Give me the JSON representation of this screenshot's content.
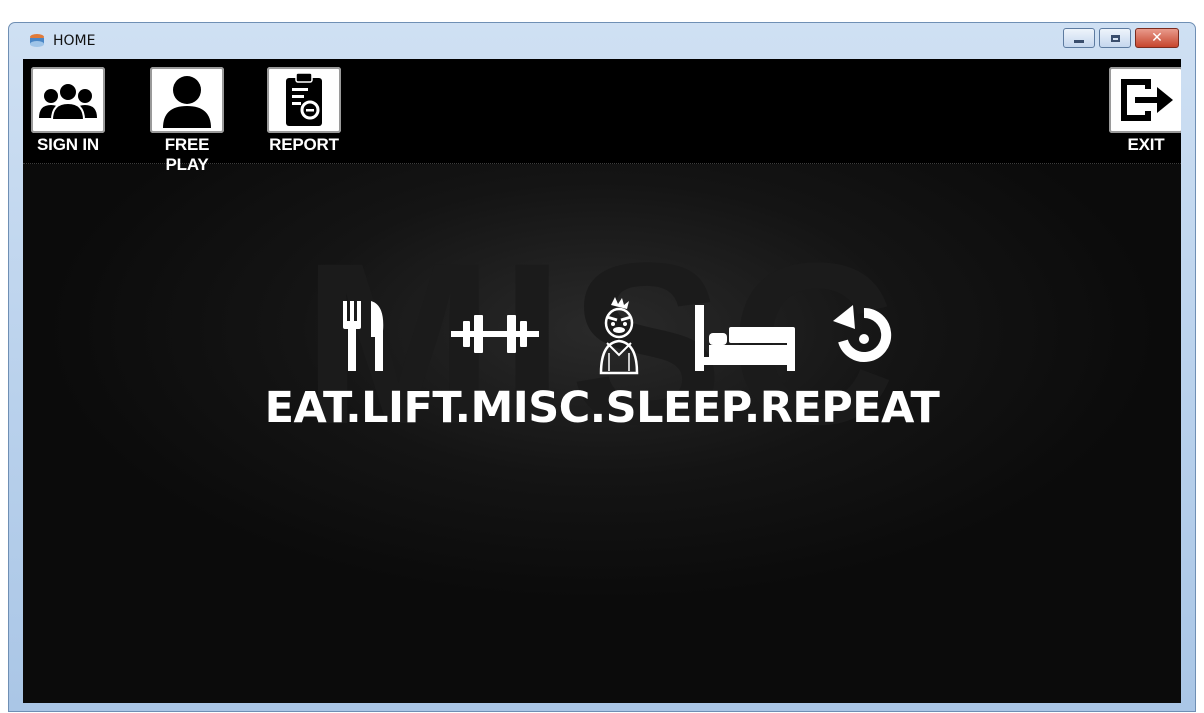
{
  "window": {
    "title": "HOME",
    "icon": "app-icon",
    "caption_buttons": [
      "minimize-icon",
      "maximize-icon",
      "close-icon"
    ],
    "close_glyph": "✕"
  },
  "toolbar": {
    "items": [
      {
        "label": "SIGN IN",
        "icon": "users-group-icon"
      },
      {
        "label": "FREE PLAY",
        "icon": "user-icon"
      },
      {
        "label": "REPORT",
        "icon": "clipboard-report-icon"
      },
      {
        "label": "EXIT",
        "icon": "exit-door-icon"
      }
    ]
  },
  "background": {
    "watermark": "MISC"
  },
  "motto": {
    "text": "EAT.LIFT.MISC.SLEEP.REPEAT",
    "icons": [
      "fork-knife-icon",
      "dumbbell-icon",
      "mascot-icon",
      "bed-icon",
      "repeat-icon"
    ]
  },
  "colors": {
    "background": "#000000",
    "text": "#ffffff",
    "titlebar": "#b9d1ec",
    "close_button": "#c6452d"
  }
}
